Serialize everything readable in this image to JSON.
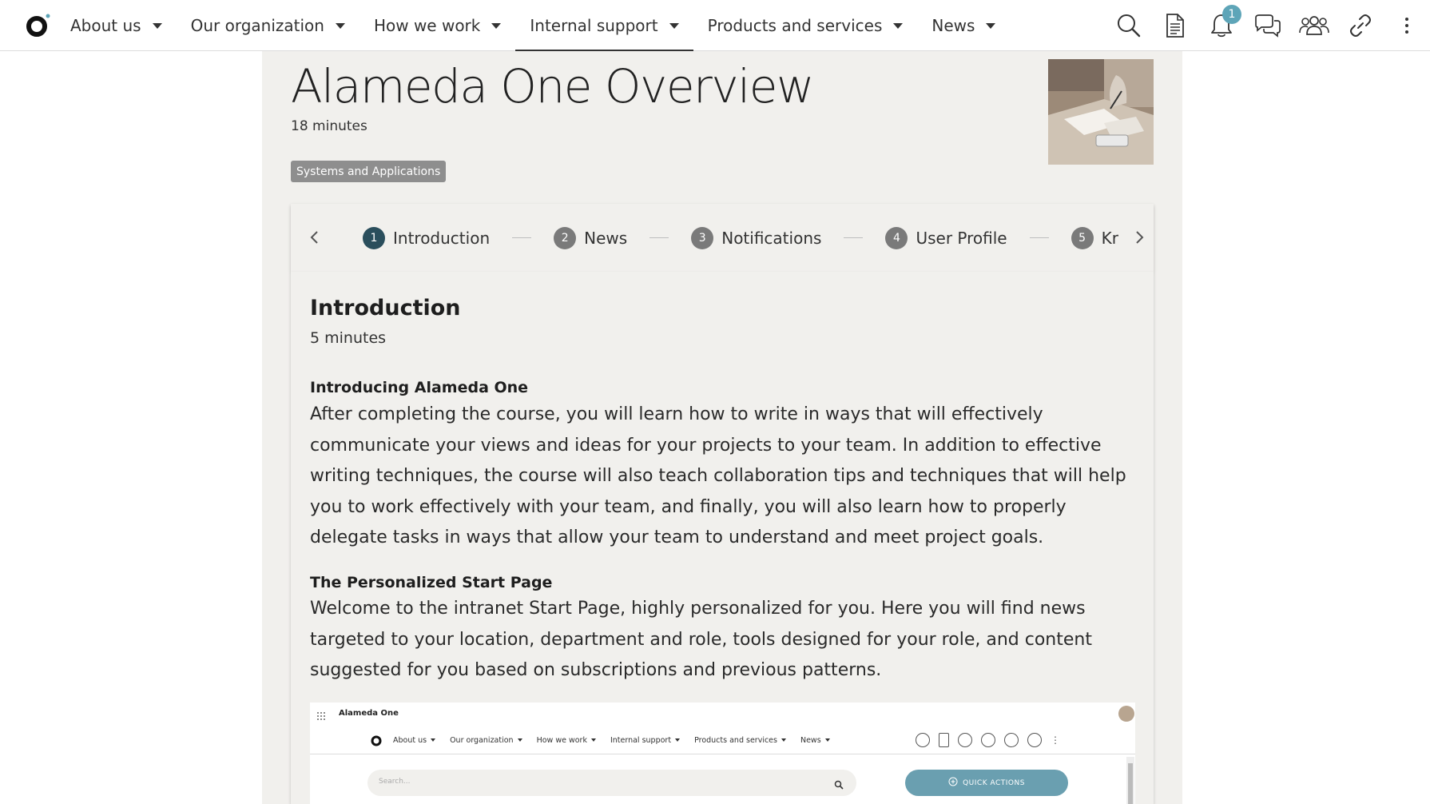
{
  "nav": {
    "items": [
      {
        "label": "About us"
      },
      {
        "label": "Our organization"
      },
      {
        "label": "How we work"
      },
      {
        "label": "Internal support"
      },
      {
        "label": "Products and services"
      },
      {
        "label": "News"
      }
    ],
    "active_index": 3,
    "notification_count": "1"
  },
  "page": {
    "title": "Alameda One Overview",
    "duration": "18 minutes",
    "tag": "Systems and Applications"
  },
  "stepper": {
    "steps": [
      {
        "num": "1",
        "label": "Introduction"
      },
      {
        "num": "2",
        "label": "News"
      },
      {
        "num": "3",
        "label": "Notifications"
      },
      {
        "num": "4",
        "label": "User Profile"
      },
      {
        "num": "5",
        "label": "Kr"
      }
    ],
    "active_index": 0
  },
  "section": {
    "title": "Introduction",
    "duration": "5 minutes",
    "blocks": [
      {
        "heading": "Introducing Alameda One",
        "text": "After completing the course, you will learn how to write in ways that will effectively communicate your views and ideas for your projects to your team. In addition to effective writing techniques, the course will also teach collaboration tips and techniques that will help you to work effectively with your team, and finally, you will also learn how to properly delegate tasks in ways that allow your team to understand and meet project goals."
      },
      {
        "heading": "The Personalized Start Page",
        "text": "Welcome to the intranet Start Page, highly personalized for you. Here you will find news targeted to your location, department and role, tools designed for your role, and content suggested for you based on subscriptions and previous patterns."
      }
    ]
  },
  "embed": {
    "app_name": "Alameda One",
    "nav_items": [
      "About us",
      "Our organization",
      "How we work",
      "Internal support",
      "Products and services",
      "News"
    ],
    "search_placeholder": "Search...",
    "quick_actions": "QUICK ACTIONS"
  },
  "colors": {
    "accent": "#5ea5b8",
    "content_bg": "#f1f0ed",
    "active_step": "#2a4e5c",
    "tag_bg": "#8e8e8e"
  }
}
